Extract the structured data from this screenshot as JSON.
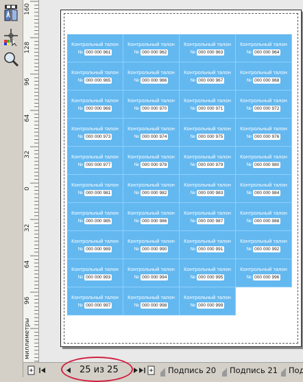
{
  "ruler": {
    "labels": [
      "160",
      "128",
      "96",
      "64",
      "32",
      "0",
      "32",
      "64",
      "96"
    ],
    "unit": "миллиметры"
  },
  "tickets": [
    {
      "title": "Контрольный талон",
      "no": "№",
      "number": "000 000 961"
    },
    {
      "title": "Контрольный талон",
      "no": "№",
      "number": "000 000 962"
    },
    {
      "title": "Контрольный талон",
      "no": "№",
      "number": "000 000 963"
    },
    {
      "title": "Контрольный талон",
      "no": "№",
      "number": "000 000 964"
    },
    {
      "title": "Контрольный талон",
      "no": "№",
      "number": "000 000 965"
    },
    {
      "title": "Контрольный талон",
      "no": "№",
      "number": "000 000 966"
    },
    {
      "title": "Контрольный талон",
      "no": "№",
      "number": "000 000 967"
    },
    {
      "title": "Контрольный талон",
      "no": "№",
      "number": "000 000 968"
    },
    {
      "title": "Контрольный талон",
      "no": "№",
      "number": "000 000 969"
    },
    {
      "title": "Контрольный талон",
      "no": "№",
      "number": "000 000 970"
    },
    {
      "title": "Контрольный талон",
      "no": "№",
      "number": "000 000 971"
    },
    {
      "title": "Контрольный талон",
      "no": "№",
      "number": "000 000 972"
    },
    {
      "title": "Контрольный талон",
      "no": "№",
      "number": "000 000 973"
    },
    {
      "title": "Контрольный талон",
      "no": "№",
      "number": "000 000 974"
    },
    {
      "title": "Контрольный талон",
      "no": "№",
      "number": "000 000 975"
    },
    {
      "title": "Контрольный талон",
      "no": "№",
      "number": "000 000 976"
    },
    {
      "title": "Контрольный талон",
      "no": "№",
      "number": "000 000 977"
    },
    {
      "title": "Контрольный талон",
      "no": "№",
      "number": "000 000 978"
    },
    {
      "title": "Контрольный талон",
      "no": "№",
      "number": "000 000 979"
    },
    {
      "title": "Контрольный талон",
      "no": "№",
      "number": "000 000 980"
    },
    {
      "title": "Контрольный талон",
      "no": "№",
      "number": "000 000 981"
    },
    {
      "title": "Контрольный талон",
      "no": "№",
      "number": "000 000 982"
    },
    {
      "title": "Контрольный талон",
      "no": "№",
      "number": "000 000 983"
    },
    {
      "title": "Контрольный талон",
      "no": "№",
      "number": "000 000 984"
    },
    {
      "title": "Контрольный талон",
      "no": "№",
      "number": "000 000 985"
    },
    {
      "title": "Контрольный талон",
      "no": "№",
      "number": "000 000 986"
    },
    {
      "title": "Контрольный талон",
      "no": "№",
      "number": "000 000 987"
    },
    {
      "title": "Контрольный талон",
      "no": "№",
      "number": "000 000 988"
    },
    {
      "title": "Контрольный талон",
      "no": "№",
      "number": "000 000 989"
    },
    {
      "title": "Контрольный талон",
      "no": "№",
      "number": "000 000 990"
    },
    {
      "title": "Контрольный талон",
      "no": "№",
      "number": "000 000 991"
    },
    {
      "title": "Контрольный талон",
      "no": "№",
      "number": "000 000 992"
    },
    {
      "title": "Контрольный талон",
      "no": "№",
      "number": "000 000 993"
    },
    {
      "title": "Контрольный талон",
      "no": "№",
      "number": "000 000 994"
    },
    {
      "title": "Контрольный талон",
      "no": "№",
      "number": "000 000 995"
    },
    {
      "title": "Контрольный талон",
      "no": "№",
      "number": "000 000 996"
    },
    {
      "title": "Контрольный талон",
      "no": "№",
      "number": "000 000 997"
    },
    {
      "title": "Контрольный талон",
      "no": "№",
      "number": "000 000 998"
    },
    {
      "title": "Контрольный талон",
      "no": "№",
      "number": "000 000 999"
    }
  ],
  "status": {
    "page_counter": "25 из 25",
    "tabs": [
      "Подпись 20",
      "Подпись 21",
      "Под"
    ]
  },
  "icons": [
    "mirror-text-icon",
    "fit-text-path-icon",
    "color-eyedropper-icon",
    "zoom-icon",
    "add-page-icon",
    "first-page-icon",
    "prev-page-icon",
    "next-page-icon",
    "last-page-icon",
    "add-page-after-icon"
  ],
  "colors": {
    "ticket_fill": "#63b8f0",
    "highlight": "#d02040"
  }
}
